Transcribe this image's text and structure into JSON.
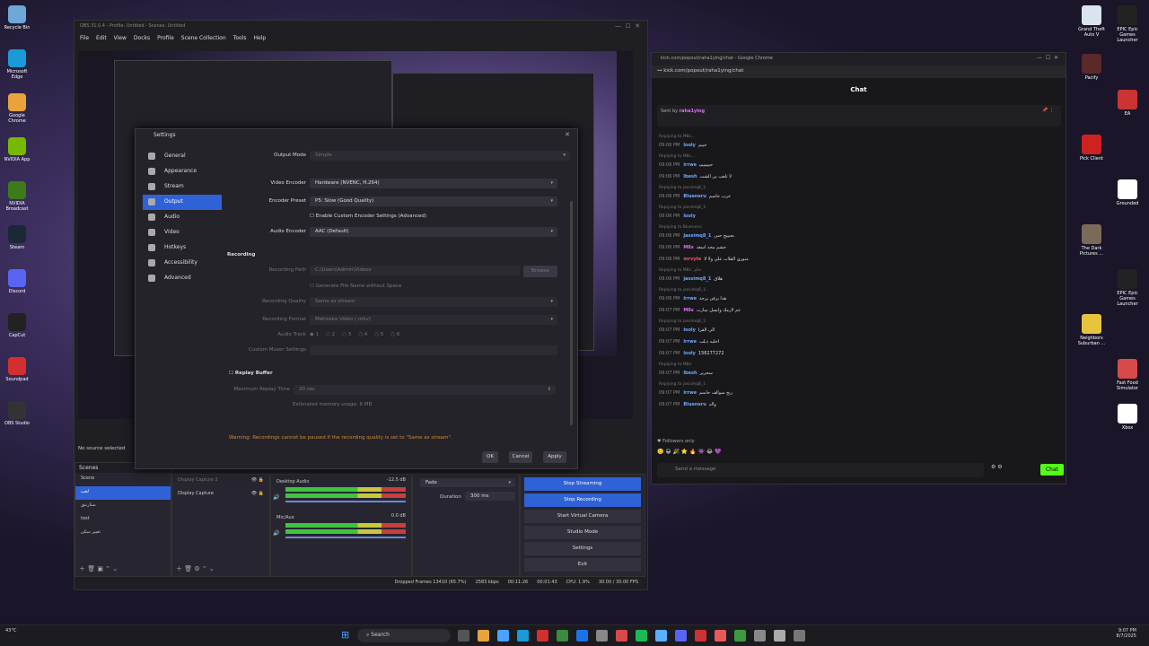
{
  "desktop_left": [
    {
      "label": "Recycle Bin",
      "color": "#6ea8d8"
    },
    {
      "label": "Microsoft Edge",
      "color": "#1a9ad6"
    },
    {
      "label": "Google Chrome",
      "color": "#e8a33d"
    },
    {
      "label": "NVIDIA App",
      "color": "#76b900"
    },
    {
      "label": "NVIDIA Broadcast",
      "color": "#3c7a1a"
    },
    {
      "label": "Steam",
      "color": "#1b2838"
    },
    {
      "label": "Discord",
      "color": "#5865f2"
    },
    {
      "label": "CapCut",
      "color": "#222222"
    },
    {
      "label": "Soundpad",
      "color": "#d32f2f"
    },
    {
      "label": "OBS Studio",
      "color": "#333333"
    }
  ],
  "desktop_right": [
    {
      "label": "Grand Theft Auto V",
      "color": "#d9e4ef"
    },
    {
      "label": "EPIC Epic Games Launcher",
      "color": "#222222"
    },
    {
      "label": "Pacify",
      "color": "#5a2a2a"
    },
    {
      "label": "EA",
      "color": "#cc3333"
    },
    {
      "label": "Pick Client",
      "color": "#cc2222"
    },
    {
      "label": "Grounded",
      "color": "#ffffff"
    },
    {
      "label": "The Dark Pictures ...",
      "color": "#7a6a5a"
    },
    {
      "label": "EPIC Epic Games Launcher",
      "color": "#222222"
    },
    {
      "label": "Neighbors Suburban ...",
      "color": "#e8c43d"
    },
    {
      "label": "Fast Food Simulator",
      "color": "#d84a4a"
    },
    {
      "label": "Xbox",
      "color": "#ffffff"
    }
  ],
  "obs": {
    "title": "OBS 31.0.4 - Profile: Untitled - Scenes: Untitled",
    "menu": [
      "File",
      "Edit",
      "View",
      "Docks",
      "Profile",
      "Scene Collection",
      "Tools",
      "Help"
    ],
    "no_source": "No source selected",
    "scenes_title": "Scenes",
    "scenes": [
      "Scene",
      "ﻟﻌﺐ",
      "ﺳﺘﺎﺭﺗﻨﻖ",
      "test",
      "ﺗﻐﻴﻴﺮ ﺳﻜﻦ"
    ],
    "sources": [
      "Display Capture 2",
      "Display Capture"
    ],
    "mixer": [
      {
        "name": "Desktop Audio",
        "db": "-12.5 dB"
      },
      {
        "name": "Mic/Aux",
        "db": "0.0 dB"
      }
    ],
    "transition": "Fade",
    "duration_label": "Duration",
    "duration": "300 ms",
    "controls": [
      "Stop Streaming",
      "Stop Recording",
      "Start Virtual Camera",
      "Studio Mode",
      "Settings",
      "Exit"
    ],
    "status": {
      "dropped": "Dropped Frames 13410 (65.7%)",
      "bitrate": "2583 kbps",
      "stream_time": "00:11:26",
      "rec_time": "00:01:43",
      "cpu": "CPU: 1.9%",
      "fps": "30.00 / 30.00 FPS"
    }
  },
  "settings": {
    "title": "Settings",
    "nav": [
      "General",
      "Appearance",
      "Stream",
      "Output",
      "Audio",
      "Video",
      "Hotkeys",
      "Accessibility",
      "Advanced"
    ],
    "selected": "Output",
    "output_mode_label": "Output Mode",
    "output_mode": "Simple",
    "video_encoder_label": "Video Encoder",
    "video_encoder": "Hardware (NVENC, H.264)",
    "encoder_preset_label": "Encoder Preset",
    "encoder_preset": "P5: Slow (Good Quality)",
    "custom_encoder_label": "Enable Custom Encoder Settings (Advanced)",
    "audio_encoder_label": "Audio Encoder",
    "audio_encoder": "AAC (Default)",
    "recording_heading": "Recording",
    "recording_path_label": "Recording Path",
    "recording_path": "C:\\Users\\Admin\\Videos",
    "browse": "Browse",
    "gen_filename": "Generate File Name without Space",
    "rec_quality_label": "Recording Quality",
    "rec_quality": "Same as stream",
    "rec_format_label": "Recording Format",
    "rec_format": "Matroska Video (.mkv)",
    "audio_track_label": "Audio Track",
    "tracks": [
      "1",
      "2",
      "3",
      "4",
      "5",
      "6"
    ],
    "muxer_label": "Custom Muxer Settings",
    "replay_label": "Replay Buffer",
    "replay_time_label": "Maximum Replay Time",
    "replay_time": "20 sec",
    "memory": "Estimated memory usage: 6 MB",
    "warning": "Warning: Recordings cannot be paused if the recording quality is set to \"Same as stream\".",
    "ok": "OK",
    "cancel": "Cancel",
    "apply": "Apply"
  },
  "chrome": {
    "title": "kick.com/popout/raha1ying/chat - Google Chrome",
    "url": "kick.com/popout/raha1ying/chat",
    "chat_title": "Chat",
    "pinned": "Sent by",
    "pinned_user": "raha1ying",
    "followers_only": "Followers only",
    "send_placeholder": "Send a message",
    "chat_button": "Chat",
    "messages": [
      {
        "reply": "Replying to M8s...",
        "time": "09:06 PM",
        "user": "looly",
        "ucolor": "#6fa8ff",
        "text": "ﺟﻴﻴﻢ"
      },
      {
        "reply": "Replying to M8s...",
        "time": "09:06 PM",
        "user": "irrwe",
        "ucolor": "#6fa8ff",
        "text": "ﺣﻴﻴﻴﻴﻴﻴﻴﻴ"
      },
      {
        "reply": "",
        "time": "09:06 PM",
        "user": "lbesh",
        "ucolor": "#6fa8ff",
        "text": "ﻻ ﺗﻠﻌﺐ ﺑﻦ ﺍﻟﺸﺖ"
      },
      {
        "reply": "Replying to jassimq8_1:",
        "time": "09:06 PM",
        "user": "Blueneru",
        "ucolor": "#6fa8ff",
        "text": "ﺧﺮﺏ ﺟﺎﺳﻢ"
      },
      {
        "reply": "Replying to jassimq8_1:",
        "time": "09:06 PM",
        "user": "looly",
        "ucolor": "#6fa8ff",
        "text": ""
      },
      {
        "reply": "Replying to Blueneru:",
        "time": "09:06 PM",
        "user": "jassimq8_1",
        "ucolor": "#6fa8ff",
        "text": "ﺑﺠﻴﻴﻴﺢ ﺣﺒﻲ"
      },
      {
        "reply": "",
        "time": "09:06 PM",
        "user": "M8s",
        "ucolor": "#d96ff0",
        "text": "ﺣﺸﻢ ﻣﺤﺪ ﺍﺳﻌﺪ"
      },
      {
        "reply": "",
        "time": "09:06 PM",
        "user": "mrvyte",
        "ucolor": "#e85a5a",
        "text": "ﻣﻨﻮﺭﻱ ﺍﻟﻘﻼﺏ ﻋﻠﻲ ﻭﻻ ﻻ"
      },
      {
        "reply": "Replying to M8s: ﺟﺎﻟﻢ",
        "time": "09:06 PM",
        "user": "jassimq8_1",
        "ucolor": "#6fa8ff",
        "text": "ﻫﻼﻕ"
      },
      {
        "reply": "Replying to jassimq8_1:",
        "time": "09:06 PM",
        "user": "irrwe",
        "ucolor": "#6fa8ff",
        "text": "ﻫﺬﺍ ﻳﺰﻓﻦ ﻳﺮﺟﺔ"
      },
      {
        "reply": "",
        "time": "09:07 PM",
        "user": "M8s",
        "ucolor": "#d96ff0",
        "text": "ﻋﻢ ﻻﺯﻣﻚ ﻭﺍﻳﺴﻞ ﺳﺎﺭﺕ"
      },
      {
        "reply": "Replying to jassimq8_1:",
        "time": "09:07 PM",
        "user": "looly",
        "ucolor": "#6fa8ff",
        "text": "ﺍﻟﻲ ﺍﻟﻘﺮﺍ"
      },
      {
        "reply": "",
        "time": "09:07 PM",
        "user": "irrwe",
        "ucolor": "#6fa8ff",
        "text": "ﺍﺧﻠﻴﻪ ﺩﻳﻠﺐ"
      },
      {
        "reply": "",
        "time": "09:07 PM",
        "user": "looly",
        "ucolor": "#6fa8ff",
        "text": "156277272"
      },
      {
        "reply": "Replying to M8s:",
        "time": "09:07 PM",
        "user": "lbesh",
        "ucolor": "#6fa8ff",
        "text": "ﺳﺤﺮﻳﺮ"
      },
      {
        "reply": "Replying to jassimq8_1:",
        "time": "09:07 PM",
        "user": "irrwe",
        "ucolor": "#6fa8ff",
        "text": "ﺭﺑﺞ ﺳﻮﺍﻟﻒ ﺟﺎﺳﻢ"
      },
      {
        "reply": "",
        "time": "09:07 PM",
        "user": "Blueneru",
        "ucolor": "#6fa8ff",
        "text": "ﻭﺍﻟﻪ"
      }
    ]
  },
  "taskbar": {
    "weather": "43°C",
    "search": "Search",
    "time": "9:07 PM",
    "date": "8/7/2025"
  }
}
